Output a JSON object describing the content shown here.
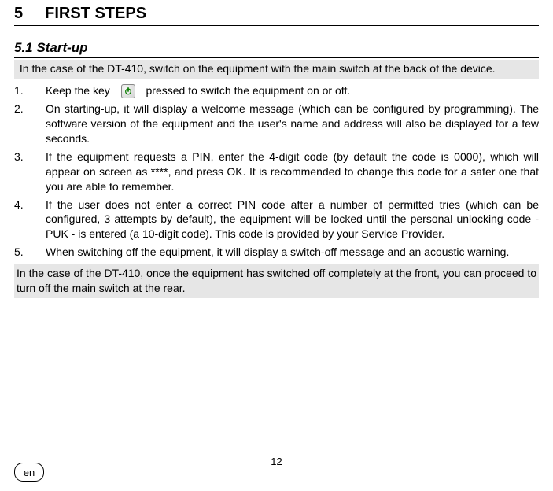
{
  "chapter": {
    "number": "5",
    "title": "FIRST STEPS"
  },
  "section": {
    "number": "5.1",
    "title": "Start-up"
  },
  "note_top": "In the case of the DT-410, switch on the equipment with the main switch at the back of the device.",
  "steps": [
    {
      "marker": "1.",
      "pre_icon": "Keep the key",
      "icon_name": "power-icon",
      "post_icon": "pressed to switch the equipment on or off."
    },
    {
      "marker": "2.",
      "text": "On starting-up, it will display a welcome message (which can be configured by programming). The software version of the equipment and the user's name and address will also be displayed for a few seconds."
    },
    {
      "marker": "3.",
      "text": "If the equipment requests a PIN, enter the 4-digit code (by default the code is 0000), which will appear on screen as ****, and press OK. It is recommended to change this code for a safer one that you are able to remember."
    },
    {
      "marker": "4.",
      "text": "If the user does not enter a correct PIN code after a number of permitted tries (which can be configured, 3 attempts by default), the equipment will be locked until the personal unlocking code - PUK - is entered (a 10-digit code). This code is provided by your Service Provider."
    },
    {
      "marker": "5.",
      "text": "When switching off the equipment, it will display a switch-off message and an acoustic warning."
    }
  ],
  "note_bottom": "In the case of the DT-410, once the equipment has switched off completely at the front, you can proceed to turn off the main switch at the rear.",
  "page_number": "12",
  "language": "en"
}
